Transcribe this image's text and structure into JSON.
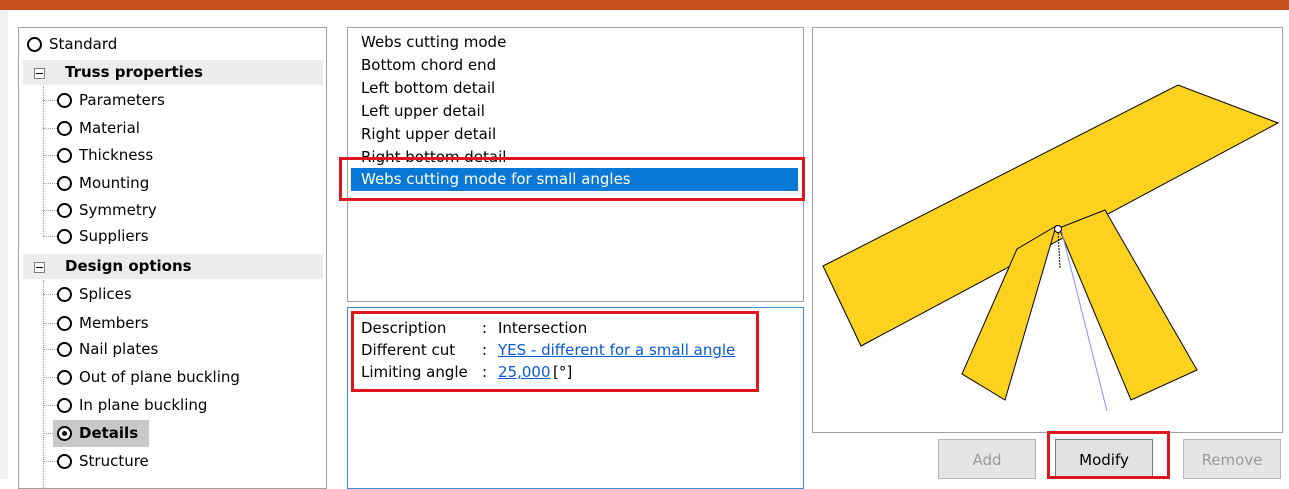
{
  "tree": {
    "standard": "Standard",
    "groups": [
      {
        "label": "Truss properties",
        "items": [
          "Parameters",
          "Material",
          "Thickness",
          "Mounting",
          "Symmetry",
          "Suppliers"
        ]
      },
      {
        "label": "Design options",
        "items": [
          "Splices",
          "Members",
          "Nail plates",
          "Out of plane buckling",
          "In plane buckling",
          "Details",
          "Structure"
        ]
      }
    ],
    "selected_item": "Details"
  },
  "detail_list": {
    "items": [
      "Webs cutting mode",
      "Bottom chord end",
      "Left bottom detail",
      "Left upper detail",
      "Right upper detail",
      "Right bottom detail",
      "Webs cutting mode for small angles"
    ],
    "selected": "Webs cutting mode for small angles"
  },
  "description": {
    "rows": [
      {
        "key": "Description",
        "sep": ":",
        "value": "Intersection",
        "unit": ""
      },
      {
        "key": "Different cut",
        "sep": ":",
        "value": "YES - different for a small angle",
        "unit": ""
      },
      {
        "key": "Limiting angle",
        "sep": ":",
        "value": "25,000",
        "unit": "[°]"
      }
    ]
  },
  "buttons": {
    "add": "Add",
    "modify": "Modify",
    "remove": "Remove"
  },
  "colors": {
    "accent_bar": "#c8501e",
    "selection": "#0a78d7",
    "highlight_box": "#e0161f",
    "member_fill": "#fdd21f",
    "link": "#0a5bd2"
  }
}
